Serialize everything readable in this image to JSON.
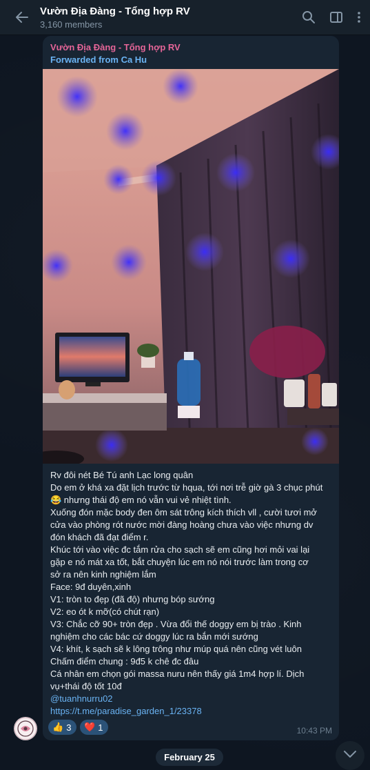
{
  "header": {
    "title": "Vườn Địa Đàng - Tổng hợp RV",
    "members": "3,160 members",
    "icons": [
      "back-arrow-icon",
      "search-icon",
      "sidebar-toggle-icon",
      "more-vertical-icon"
    ]
  },
  "message": {
    "sender": "Vườn Địa Đàng - Tổng hợp RV",
    "forwarded_from": "Forwarded from Ca Hu",
    "lines": [
      "Rv đôi nét Bé Tú anh Lạc long quân",
      "Do em ở khá xa đặt lịch trước từ hqua, tới nơi trễ giờ gà 3 chục phút",
      "😂 nhưng thái độ em nó vẫn vui vẻ nhiệt tình.",
      "Xuống đón mặc body đen ôm sát trông kích thích vll , cười tươi mở",
      "cửa vào phòng rót nước mời đàng hoàng chưa vào việc nhưng dv",
      "đón khách đã đạt điểm r.",
      "Khúc tới vào việc đc tắm rửa cho sạch sẽ em cũng hơi mỏi vai lại",
      "gặp e nó mát xa tốt, bắt chuyện lúc em nó nói trước làm trong cơ",
      "sở ra nên kinh nghiệm lắm",
      "Face: 9đ duyên,xinh",
      "V1: tròn to đẹp (đã độ) nhưng bóp sướng",
      "V2: eo ót k mỡ(có chút rạn)",
      "V3: Chắc cỡ 90+ tròn đẹp . Vừa đổi thế doggy em bị trào . Kinh",
      "nghiệm cho các bác cứ doggy lúc ra bắn mới sướng",
      "V4: khít, k sạch sẽ k lông trông như múp quá nên cũng vét luôn",
      "Chấm điểm chung : 9đ5 k chê đc đâu",
      "Cá nhân em chọn gói  massa nuru nên thấy giá 1m4 hợp lí. Dịch",
      "vụ+thái độ tốt 10đ"
    ],
    "mention": "@tuanhnurru02",
    "link": "https://t.me/paradise_garden_1/23378",
    "reactions": [
      {
        "emoji": "👍",
        "count": "3"
      },
      {
        "emoji": "❤️",
        "count": "1"
      }
    ],
    "time": "10:43 PM",
    "photo": "photo of a room with a TV, curtains and purple-blue disco light spots"
  },
  "date_separator": "February 25",
  "colors": {
    "background": "#0e1621",
    "header": "#17212b",
    "bubble": "#182533",
    "sender": "#e56598",
    "link": "#6ab3f3",
    "reaction": "#2b5278"
  }
}
